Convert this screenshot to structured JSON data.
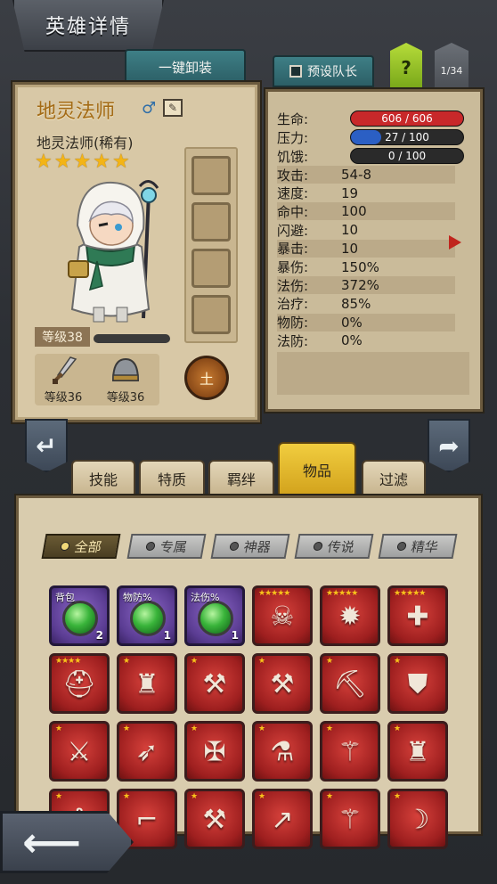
{
  "header": {
    "title": "英雄详情"
  },
  "top_buttons": {
    "unequip_all": "一键卸装",
    "preset_captain": "预设队长",
    "help": "?",
    "page": "1/34"
  },
  "hero": {
    "name": "地灵法师",
    "subname": "地灵法师(稀有)",
    "stars": [
      "★",
      "★",
      "★",
      "★",
      "★"
    ],
    "level": "等级38",
    "weapon_level": "等级36",
    "armor_level": "等级36",
    "element": "土"
  },
  "stats": {
    "hp": {
      "label": "生命:",
      "value": "606 / 606",
      "ratio": 1.0,
      "color": "#c8282a"
    },
    "stress": {
      "label": "压力:",
      "value": "27 / 100",
      "ratio": 0.27,
      "color": "#2b5fc4"
    },
    "hunger": {
      "label": "饥饿:",
      "value": "0 / 100",
      "ratio": 0.0,
      "color": "#555555"
    },
    "rows": [
      {
        "label": "攻击:",
        "value": "54-8"
      },
      {
        "label": "速度:",
        "value": "19"
      },
      {
        "label": "命中:",
        "value": "100"
      },
      {
        "label": "闪避:",
        "value": "10"
      },
      {
        "label": "暴击:",
        "value": "10"
      },
      {
        "label": "暴伤:",
        "value": "150%"
      },
      {
        "label": "法伤:",
        "value": "372%"
      },
      {
        "label": "治疗:",
        "value": "85%"
      },
      {
        "label": "物防:",
        "value": "0%"
      },
      {
        "label": "法防:",
        "value": "0%"
      }
    ]
  },
  "tabs": [
    "技能",
    "特质",
    "羁绊",
    "物品",
    "过滤"
  ],
  "filters": [
    "全部",
    "专属",
    "神器",
    "传说",
    "精华"
  ],
  "inventory": [
    {
      "tag": "背包",
      "count": "2",
      "type": "gem",
      "color": "purple"
    },
    {
      "tag": "物防%",
      "count": "1",
      "type": "gem",
      "color": "purple"
    },
    {
      "tag": "法伤%",
      "count": "1",
      "type": "gem",
      "color": "purple"
    },
    {
      "stars": "★★★★★",
      "icon": "skull-icon",
      "glyph": "☠"
    },
    {
      "stars": "★★★★★",
      "icon": "bomb-icon",
      "glyph": "✹"
    },
    {
      "stars": "★★★★★",
      "icon": "medkit-icon",
      "glyph": "✚"
    },
    {
      "stars": "★★★★",
      "icon": "helmet-icon",
      "glyph": "⛑"
    },
    {
      "stars": "★",
      "icon": "armor-icon",
      "glyph": "♜"
    },
    {
      "stars": "★",
      "icon": "axe-icon",
      "glyph": "⚒"
    },
    {
      "stars": "★",
      "icon": "axe-icon",
      "glyph": "⚒"
    },
    {
      "stars": "★",
      "icon": "pickaxe-icon",
      "glyph": "⛏"
    },
    {
      "stars": "★",
      "icon": "shield-icon",
      "glyph": "⛊"
    },
    {
      "stars": "★",
      "icon": "crossed-swords-icon",
      "glyph": "⚔"
    },
    {
      "stars": "★",
      "icon": "bow-icon",
      "glyph": "➶"
    },
    {
      "stars": "★",
      "icon": "crossbow-icon",
      "glyph": "✠"
    },
    {
      "stars": "★",
      "icon": "potion-icon",
      "glyph": "⚗"
    },
    {
      "stars": "★",
      "icon": "staff-icon",
      "glyph": "⚚"
    },
    {
      "stars": "★",
      "icon": "armor-icon",
      "glyph": "♜"
    },
    {
      "stars": "★",
      "icon": "claw-icon",
      "glyph": "⟆"
    },
    {
      "stars": "★",
      "icon": "rifle-icon",
      "glyph": "⌐"
    },
    {
      "stars": "★",
      "icon": "battleaxe-icon",
      "glyph": "⚒"
    },
    {
      "stars": "★",
      "icon": "spear-icon",
      "glyph": "↗"
    },
    {
      "stars": "★",
      "icon": "wand-icon",
      "glyph": "⚚"
    },
    {
      "stars": "★",
      "icon": "blade-icon",
      "glyph": "☽"
    }
  ]
}
